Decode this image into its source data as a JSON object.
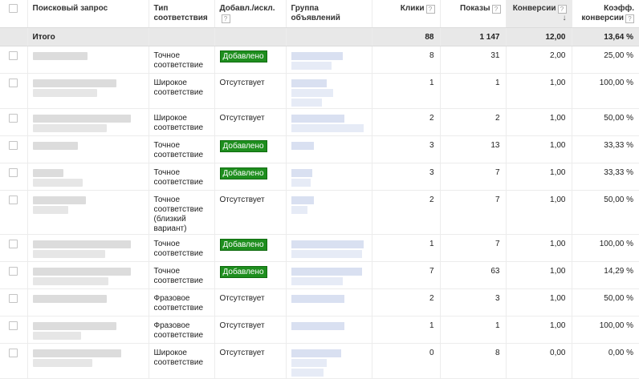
{
  "headers": {
    "query": "Поисковый запрос",
    "match_type_l1": "Тип",
    "match_type_l2": "соответствия",
    "added": "Добавл./искл.",
    "ad_group": "Группа объявлений",
    "clicks": "Клики",
    "impressions": "Показы",
    "conversions": "Конверсии",
    "conv_rate_l1": "Коэфф.",
    "conv_rate_l2": "конверсии",
    "help_glyph": "?",
    "sort_arrow": "↓"
  },
  "total": {
    "label": "Итого",
    "clicks": "88",
    "impressions": "1 147",
    "conversions": "12,00",
    "conv_rate": "13,64 %"
  },
  "rows": [
    {
      "match_l1": "Точное",
      "match_l2": "соответствие",
      "match_l3": "",
      "match_l4": "",
      "added": "Добавлено",
      "added_badge": true,
      "clicks": "8",
      "impressions": "31",
      "conversions": "2,00",
      "conv_rate": "25,00 %"
    },
    {
      "match_l1": "Широкое",
      "match_l2": "соответствие",
      "match_l3": "",
      "match_l4": "",
      "added": "Отсутствует",
      "added_badge": false,
      "clicks": "1",
      "impressions": "1",
      "conversions": "1,00",
      "conv_rate": "100,00 %"
    },
    {
      "match_l1": "Широкое",
      "match_l2": "соответствие",
      "match_l3": "",
      "match_l4": "",
      "added": "Отсутствует",
      "added_badge": false,
      "clicks": "2",
      "impressions": "2",
      "conversions": "1,00",
      "conv_rate": "50,00 %"
    },
    {
      "match_l1": "Точное",
      "match_l2": "соответствие",
      "match_l3": "",
      "match_l4": "",
      "added": "Добавлено",
      "added_badge": true,
      "clicks": "3",
      "impressions": "13",
      "conversions": "1,00",
      "conv_rate": "33,33 %"
    },
    {
      "match_l1": "Точное",
      "match_l2": "соответствие",
      "match_l3": "",
      "match_l4": "",
      "added": "Добавлено",
      "added_badge": true,
      "clicks": "3",
      "impressions": "7",
      "conversions": "1,00",
      "conv_rate": "33,33 %"
    },
    {
      "match_l1": "Точное",
      "match_l2": "соответствие",
      "match_l3": "(близкий",
      "match_l4": "вариант)",
      "added": "Отсутствует",
      "added_badge": false,
      "clicks": "2",
      "impressions": "7",
      "conversions": "1,00",
      "conv_rate": "50,00 %"
    },
    {
      "match_l1": "Точное",
      "match_l2": "соответствие",
      "match_l3": "",
      "match_l4": "",
      "added": "Добавлено",
      "added_badge": true,
      "clicks": "1",
      "impressions": "7",
      "conversions": "1,00",
      "conv_rate": "100,00 %"
    },
    {
      "match_l1": "Точное",
      "match_l2": "соответствие",
      "match_l3": "",
      "match_l4": "",
      "added": "Добавлено",
      "added_badge": true,
      "clicks": "7",
      "impressions": "63",
      "conversions": "1,00",
      "conv_rate": "14,29 %"
    },
    {
      "match_l1": "Фразовое",
      "match_l2": "соответствие",
      "match_l3": "",
      "match_l4": "",
      "added": "Отсутствует",
      "added_badge": false,
      "clicks": "2",
      "impressions": "3",
      "conversions": "1,00",
      "conv_rate": "50,00 %"
    },
    {
      "match_l1": "Фразовое",
      "match_l2": "соответствие",
      "match_l3": "",
      "match_l4": "",
      "added": "Отсутствует",
      "added_badge": false,
      "clicks": "1",
      "impressions": "1",
      "conversions": "1,00",
      "conv_rate": "100,00 %"
    },
    {
      "match_l1": "Широкое",
      "match_l2": "соответствие",
      "match_l3": "",
      "match_l4": "",
      "added": "Отсутствует",
      "added_badge": false,
      "clicks": "0",
      "impressions": "8",
      "conversions": "0,00",
      "conv_rate": "0,00 %"
    }
  ],
  "colors": {
    "added_badge_bg": "#1e8e1e",
    "total_row_bg": "#e8e8e8",
    "sorted_header_bg": "#ebebeb",
    "redacted_query": "#dcdcdc",
    "redacted_group": "#d9e0f1"
  },
  "icons": {
    "help": "question-mark-box-icon",
    "sort": "sort-down-arrow-icon",
    "checkbox": "checkbox-icon"
  }
}
